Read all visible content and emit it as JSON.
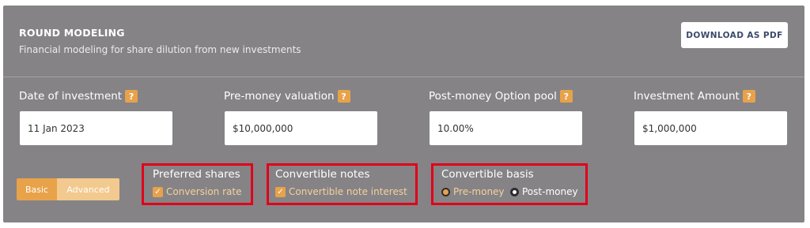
{
  "header": {
    "title": "ROUND MODELING",
    "subtitle": "Financial modeling for share dilution from new investments",
    "download_label": "DOWNLOAD AS PDF"
  },
  "fields": [
    {
      "label": "Date of investment",
      "value": "11 Jan 2023",
      "help": "?"
    },
    {
      "label": "Pre-money valuation",
      "value": "$10,000,000",
      "help": "?"
    },
    {
      "label": "Post-money Option pool",
      "value": "10.00%",
      "help": "?"
    },
    {
      "label": "Investment Amount",
      "value": "$1,000,000",
      "help": "?"
    }
  ],
  "mode_toggle": {
    "active": "Basic",
    "inactive": "Advanced"
  },
  "groups": {
    "preferred_shares": {
      "title": "Preferred shares",
      "option": "Conversion rate",
      "checked": true
    },
    "convertible_notes": {
      "title": "Convertible notes",
      "option": "Convertible note interest",
      "checked": true
    },
    "convertible_basis": {
      "title": "Convertible basis",
      "options": [
        {
          "label": "Pre-money",
          "selected": false
        },
        {
          "label": "Post-money",
          "selected": true
        }
      ]
    }
  },
  "colors": {
    "panel": "#858386",
    "accent": "#e8a24a",
    "highlight_border": "#e1001a"
  },
  "icons": {
    "checkbox": "check-icon",
    "help": "question-icon"
  }
}
